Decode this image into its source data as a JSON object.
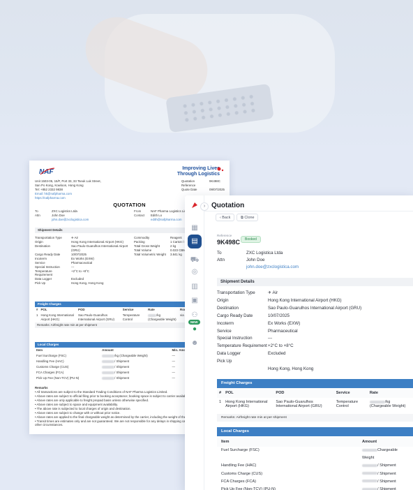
{
  "doc": {
    "logo_text": "NAF",
    "tagline_1": "Improving Lives",
    "tagline_2": "Through Logistics",
    "address": [
      "Unit 1503-05, 15/F, Port 33, 33 Tseuk Luk Street,",
      "San Po Kong, Kowloon, Hong Kong",
      "Tel: +852 2332 9838",
      "Email: hk@nafpharma.com",
      "https://nafpharma.com"
    ],
    "quotation_ref_label": "Quotation Reference",
    "quotation_ref": "9K498C",
    "quote_date_label": "Quote Date",
    "quote_date": "09/07/2025",
    "title": "QUOTATION",
    "to_label": "To",
    "to_value": "ZXC Logistics Ltda",
    "attn_label": "Attn",
    "attn_value": "John Doe",
    "attn_email": "john.doe@zxclogistica.com",
    "from_label": "From",
    "from_value": "NAF Pharma Logistics Limited",
    "contact_label": "Contact",
    "contact_value": "Edith Lo",
    "contact_email": "edith@nafpharma.com",
    "shipment_details": "Shipment Details",
    "left_details": [
      [
        "Transportation Type",
        "✈ Air"
      ],
      [
        "Origin",
        "Hong Kong International Airport (HKG)"
      ],
      [
        "Destination",
        "Sao Paulo-Guarulhos International Airport (GRU)"
      ],
      [
        "Cargo Ready Date",
        "10/07/2025"
      ],
      [
        "Incoterm",
        "Ex Works (EXW)"
      ],
      [
        "Service",
        "Pharmaceutical"
      ],
      [
        "Special Instruction",
        "---"
      ],
      [
        "Temperature Requirement",
        "+2°C to +8°C"
      ],
      [
        "Data Logger",
        "Excluded"
      ],
      [
        "Pick Up",
        "Hong Kong, Hong Kong"
      ]
    ],
    "right_details": [
      [
        "Commodity",
        "Reagent"
      ],
      [
        "Packing",
        "1 Carton / EW"
      ],
      [
        "Total Gross Weight",
        "2 kg"
      ],
      [
        "Total Volume",
        "0.023 CBM"
      ],
      [
        "Total Volumetric Weight",
        "3.841 kg"
      ]
    ],
    "freight_charges": "Freight Charges",
    "freight_headers": [
      "#",
      "POL",
      "POD",
      "Service",
      "Rate",
      "Routing",
      "T/T",
      "Validity"
    ],
    "freight_row": [
      "1",
      "Hong Kong International Airport (HKG)",
      "Sao Paulo-Guarulhos International Airport (GRU)",
      "Temperature Control",
      "/kg (Chargeable Weight)",
      "via FRA",
      "+2-3 days",
      "30/07/2025"
    ],
    "freight_remarks": "Remarks: Airfreight rate min at        per shipment",
    "local_charges": "Local Charges",
    "local_headers": [
      "Item",
      "Amount",
      "Min. Amount",
      "Remarks"
    ],
    "local_rows": [
      [
        "Fuel Surcharge (FSC)",
        "/kg (Chargeable Weight)",
        "—",
        "—"
      ],
      [
        "Handling Fee (HAC)",
        "/ Shipment",
        "—",
        "—"
      ],
      [
        "Customs Charge (CUS)",
        "/ Shipment",
        "—",
        "—"
      ],
      [
        "FCA Charges (FCA)",
        "/ Shipment",
        "—",
        "—"
      ],
      [
        "Pick Up Fee (Non-TCV) (PU-N)",
        "/ Shipment",
        "—",
        "per PO"
      ]
    ],
    "remarks_title": "Remarks",
    "remarks": [
      "All transactions are subject to the Standard Trading Conditions of NAF Pharma Logistics Limited.",
      "Above rates are subject to official filing prior to booking acceptance; booking space is subject to carrier availability.",
      "Above rates are only applicable to freight prepaid basis unless otherwise specified.",
      "Above rates are subject to space and equipment availability.",
      "The above rate is subjected to local charges of origin and destination.",
      "Above rates are subject to change with or without prior notice.",
      "Above rates are applied to the final chargeable weight as determined by the carrier, including the weight of the packages and container.",
      "Transit times are estimates only and are not guaranteed. We are not responsible for any delays in shipping caused by carriers, weather or other circumstances."
    ]
  },
  "app": {
    "title": "Quotation",
    "back_label": "Back",
    "clone_label": "Clone",
    "reference_label": "Reference",
    "reference": "9K498C",
    "status": "Booked",
    "to_label": "To",
    "to_value": "ZXC Logistica Ltda",
    "attn_label": "Attn",
    "attn_value": "John Doe",
    "attn_email": "john.doe@zxclogistica.com",
    "new_badge": "NEW",
    "shipment_details": "Shipment Details",
    "details": [
      [
        "Transportation Type",
        "✈ Air"
      ],
      [
        "Origin",
        "Hong Kong International Airport (HKG)"
      ],
      [
        "Destination",
        "Sao Paulo-Guarulhos International Airport (GRU)"
      ],
      [
        "Cargo Ready Date",
        "10/07/2025"
      ],
      [
        "Incoterm",
        "Ex Works (EXW)"
      ],
      [
        "Service",
        "Pharmaceutical"
      ],
      [
        "Special Instruction",
        "---"
      ],
      [
        "Temperature Requirement",
        "+2°C to +8°C"
      ],
      [
        "Data Logger",
        "Excluded"
      ],
      [
        "Pick Up",
        ""
      ],
      [
        "",
        "Hong Kong, Hong Kong"
      ]
    ],
    "freight_charges": "Freight Charges",
    "freight_headers": [
      "#",
      "POL",
      "POD",
      "Service",
      "Rate"
    ],
    "freight_row": [
      "1",
      "Hong Kong International Airport (HKG)",
      "Sao Paulo-Guarulhos International Airport (GRU)",
      "Temperature Control",
      "/kg (Chargeable Weight)"
    ],
    "freight_remarks": "Remarks: Airfreight rate min at        per shipment",
    "local_charges": "Local Charges",
    "local_headers": [
      "Item",
      "Amount"
    ],
    "local_rows": [
      [
        "Fuel Surcharge (FSC)",
        "Chargeable Weight"
      ],
      [
        "Handling Fee (HAC)",
        "/ Shipment"
      ],
      [
        "Customs Charge (CUS)",
        "/ Shipment"
      ],
      [
        "FCA Charges (FCA)",
        "/ Shipment"
      ],
      [
        "Pick Up Fee (Non-TCV) (PU-N)",
        "/ Shipment"
      ]
    ],
    "colors": {
      "primary": "#1f4f8f",
      "accent": "#3d7fc4",
      "success": "#2e9b5f"
    }
  }
}
